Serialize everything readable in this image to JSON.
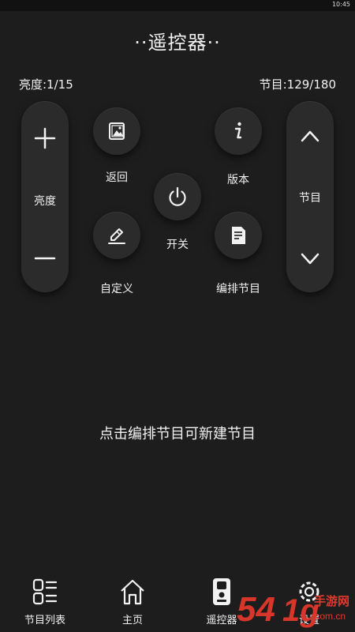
{
  "status": {
    "time": "10:45"
  },
  "header": {
    "title": "··遥控器··"
  },
  "info": {
    "brightness": "亮度:1/15",
    "program": "节目:129/180"
  },
  "controls": {
    "brightness_label": "亮度",
    "back_label": "返回",
    "custom_label": "自定义",
    "power_label": "开关",
    "version_label": "版本",
    "edit_label": "编排节目",
    "program_label": "节目"
  },
  "hint": "点击编排节目可新建节目",
  "tabbar": {
    "tabs": [
      {
        "label": "节目列表",
        "icon": "list-icon"
      },
      {
        "label": "主页",
        "icon": "home-icon"
      },
      {
        "label": "遥控器",
        "icon": "remote-icon"
      },
      {
        "label": "设置",
        "icon": "gear-icon"
      }
    ]
  },
  "watermark": {
    "number": "54",
    "logo": "手游网",
    "domain": ".com.cn"
  }
}
